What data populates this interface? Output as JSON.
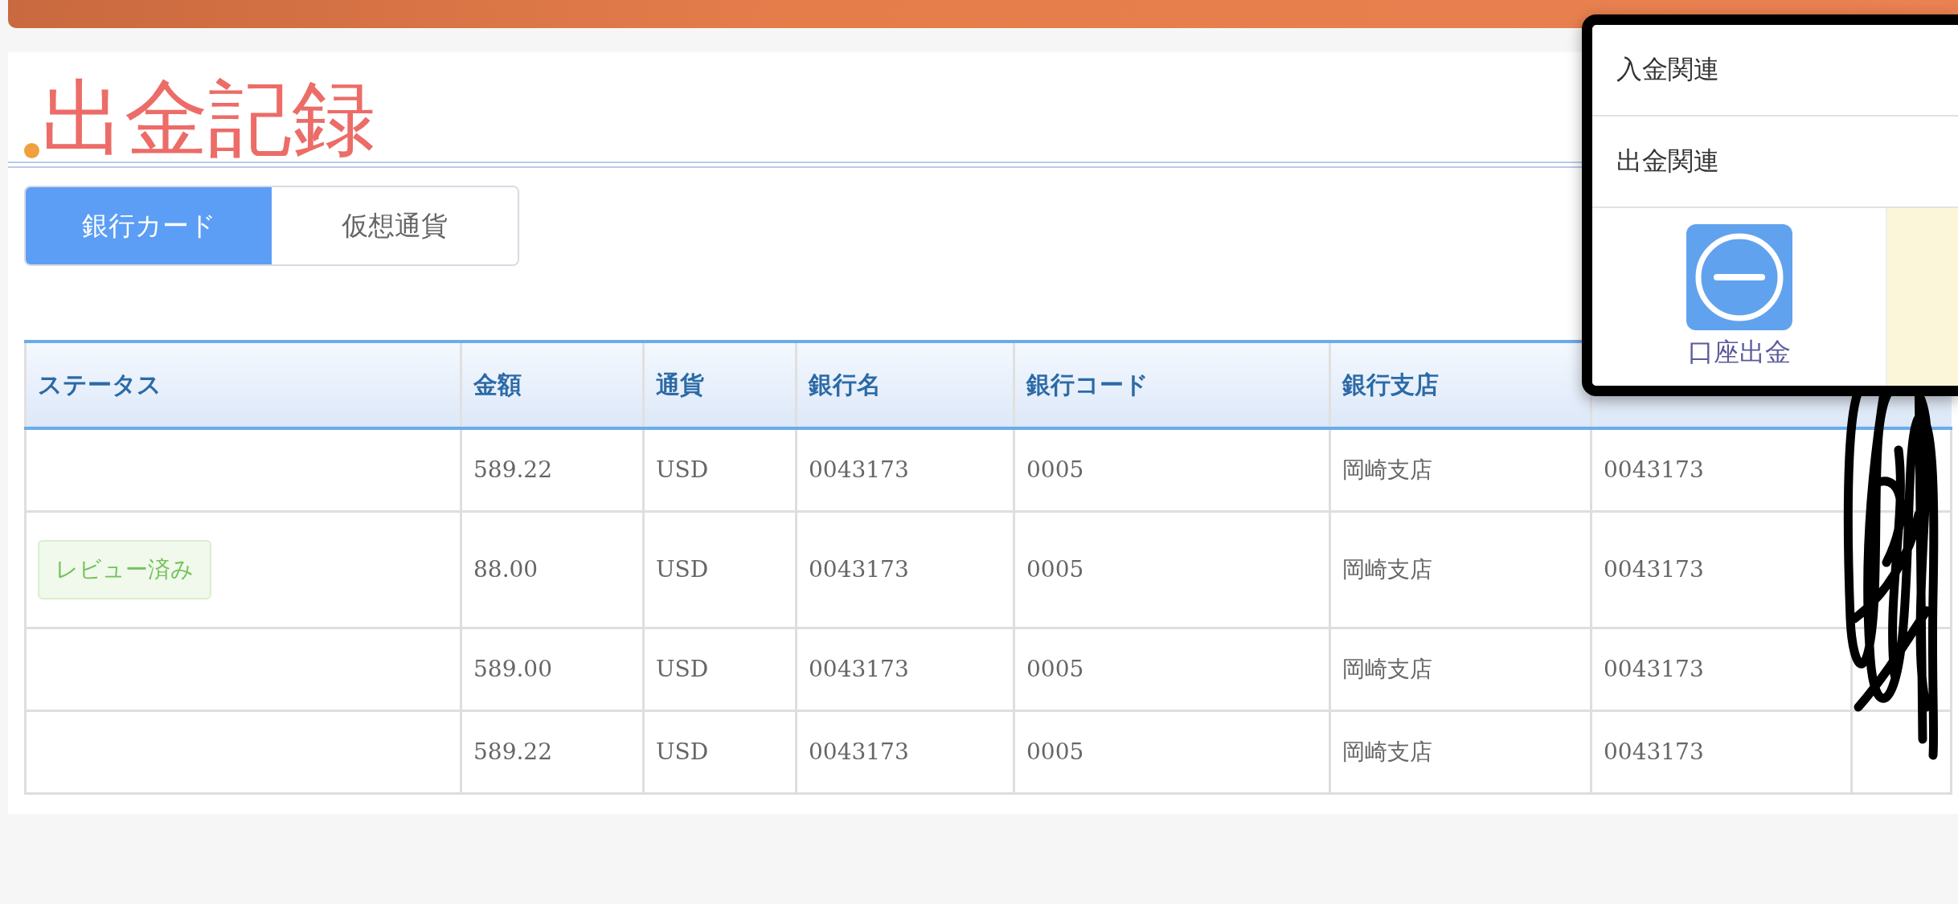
{
  "page_title": "出金記録",
  "tabs": [
    {
      "label": "銀行カード",
      "selected": true
    },
    {
      "label": "仮想通貨",
      "selected": false
    }
  ],
  "table": {
    "columns": [
      "ステータス",
      "金額",
      "通貨",
      "銀行名",
      "銀行コード",
      "銀行支店"
    ],
    "rows": [
      {
        "cells": [
          "",
          "589.22",
          "USD",
          "0043173",
          "0005",
          "岡崎支店",
          "0043173"
        ]
      },
      {
        "status_badge": true,
        "cells": [
          "レビュー済み",
          "88.00",
          "USD",
          "0043173",
          "0005",
          "岡崎支店",
          "0043173"
        ]
      },
      {
        "cells": [
          "",
          "589.00",
          "USD",
          "0043173",
          "0005",
          "岡崎支店",
          "0043173"
        ]
      },
      {
        "cells": [
          "",
          "589.22",
          "USD",
          "0043173",
          "0005",
          "岡崎支店",
          "0043173"
        ]
      }
    ],
    "last_column_scribbled": true
  },
  "menu": {
    "items": [
      "入金関連",
      "出金関連"
    ],
    "actions": [
      {
        "label": "口座出金",
        "kind": "withdraw"
      }
    ]
  }
}
